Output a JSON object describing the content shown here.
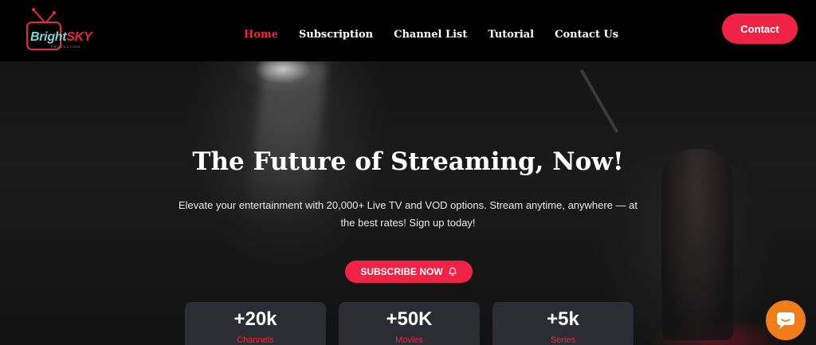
{
  "brand": {
    "name_part1": "Bright",
    "name_part2": "SKY",
    "tagline": "PRODUCTION"
  },
  "nav": {
    "items": [
      {
        "label": "Home",
        "active": true
      },
      {
        "label": "Subscription",
        "active": false
      },
      {
        "label": "Channel List",
        "active": false
      },
      {
        "label": "Tutorial",
        "active": false
      },
      {
        "label": "Contact Us",
        "active": false
      }
    ],
    "contact_label": "Contact"
  },
  "hero": {
    "title": "The Future of Streaming, Now!",
    "subtitle_line1": "Elevate your entertainment with 20,000+ Live TV and VOD options. Stream anytime, anywhere — at",
    "subtitle_line2": "the best rates! Sign up today!",
    "cta_label": "SUBSCRIBE NOW",
    "cta_icon": "bell-icon"
  },
  "stats": [
    {
      "value": "+20k",
      "label": "Channels"
    },
    {
      "value": "+50K",
      "label": "Movies"
    },
    {
      "value": "+5k",
      "label": "Series"
    }
  ],
  "chat_icon": "chat-bubble-icon",
  "colors": {
    "accent": "#ef2346",
    "chat": "#ef7d1a",
    "card": "#2b2d33"
  }
}
